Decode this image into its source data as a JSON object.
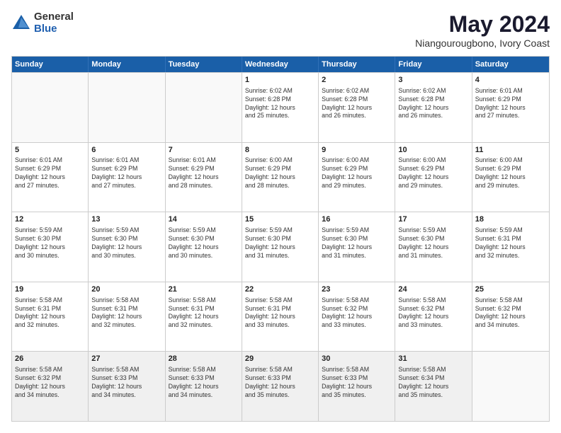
{
  "logo": {
    "general": "General",
    "blue": "Blue"
  },
  "title": "May 2024",
  "subtitle": "Niangourougbono, Ivory Coast",
  "days": [
    "Sunday",
    "Monday",
    "Tuesday",
    "Wednesday",
    "Thursday",
    "Friday",
    "Saturday"
  ],
  "rows": [
    [
      {
        "day": "",
        "text": ""
      },
      {
        "day": "",
        "text": ""
      },
      {
        "day": "",
        "text": ""
      },
      {
        "day": "1",
        "text": "Sunrise: 6:02 AM\nSunset: 6:28 PM\nDaylight: 12 hours\nand 25 minutes."
      },
      {
        "day": "2",
        "text": "Sunrise: 6:02 AM\nSunset: 6:28 PM\nDaylight: 12 hours\nand 26 minutes."
      },
      {
        "day": "3",
        "text": "Sunrise: 6:02 AM\nSunset: 6:28 PM\nDaylight: 12 hours\nand 26 minutes."
      },
      {
        "day": "4",
        "text": "Sunrise: 6:01 AM\nSunset: 6:29 PM\nDaylight: 12 hours\nand 27 minutes."
      }
    ],
    [
      {
        "day": "5",
        "text": "Sunrise: 6:01 AM\nSunset: 6:29 PM\nDaylight: 12 hours\nand 27 minutes."
      },
      {
        "day": "6",
        "text": "Sunrise: 6:01 AM\nSunset: 6:29 PM\nDaylight: 12 hours\nand 27 minutes."
      },
      {
        "day": "7",
        "text": "Sunrise: 6:01 AM\nSunset: 6:29 PM\nDaylight: 12 hours\nand 28 minutes."
      },
      {
        "day": "8",
        "text": "Sunrise: 6:00 AM\nSunset: 6:29 PM\nDaylight: 12 hours\nand 28 minutes."
      },
      {
        "day": "9",
        "text": "Sunrise: 6:00 AM\nSunset: 6:29 PM\nDaylight: 12 hours\nand 29 minutes."
      },
      {
        "day": "10",
        "text": "Sunrise: 6:00 AM\nSunset: 6:29 PM\nDaylight: 12 hours\nand 29 minutes."
      },
      {
        "day": "11",
        "text": "Sunrise: 6:00 AM\nSunset: 6:29 PM\nDaylight: 12 hours\nand 29 minutes."
      }
    ],
    [
      {
        "day": "12",
        "text": "Sunrise: 5:59 AM\nSunset: 6:30 PM\nDaylight: 12 hours\nand 30 minutes."
      },
      {
        "day": "13",
        "text": "Sunrise: 5:59 AM\nSunset: 6:30 PM\nDaylight: 12 hours\nand 30 minutes."
      },
      {
        "day": "14",
        "text": "Sunrise: 5:59 AM\nSunset: 6:30 PM\nDaylight: 12 hours\nand 30 minutes."
      },
      {
        "day": "15",
        "text": "Sunrise: 5:59 AM\nSunset: 6:30 PM\nDaylight: 12 hours\nand 31 minutes."
      },
      {
        "day": "16",
        "text": "Sunrise: 5:59 AM\nSunset: 6:30 PM\nDaylight: 12 hours\nand 31 minutes."
      },
      {
        "day": "17",
        "text": "Sunrise: 5:59 AM\nSunset: 6:30 PM\nDaylight: 12 hours\nand 31 minutes."
      },
      {
        "day": "18",
        "text": "Sunrise: 5:59 AM\nSunset: 6:31 PM\nDaylight: 12 hours\nand 32 minutes."
      }
    ],
    [
      {
        "day": "19",
        "text": "Sunrise: 5:58 AM\nSunset: 6:31 PM\nDaylight: 12 hours\nand 32 minutes."
      },
      {
        "day": "20",
        "text": "Sunrise: 5:58 AM\nSunset: 6:31 PM\nDaylight: 12 hours\nand 32 minutes."
      },
      {
        "day": "21",
        "text": "Sunrise: 5:58 AM\nSunset: 6:31 PM\nDaylight: 12 hours\nand 32 minutes."
      },
      {
        "day": "22",
        "text": "Sunrise: 5:58 AM\nSunset: 6:31 PM\nDaylight: 12 hours\nand 33 minutes."
      },
      {
        "day": "23",
        "text": "Sunrise: 5:58 AM\nSunset: 6:32 PM\nDaylight: 12 hours\nand 33 minutes."
      },
      {
        "day": "24",
        "text": "Sunrise: 5:58 AM\nSunset: 6:32 PM\nDaylight: 12 hours\nand 33 minutes."
      },
      {
        "day": "25",
        "text": "Sunrise: 5:58 AM\nSunset: 6:32 PM\nDaylight: 12 hours\nand 34 minutes."
      }
    ],
    [
      {
        "day": "26",
        "text": "Sunrise: 5:58 AM\nSunset: 6:32 PM\nDaylight: 12 hours\nand 34 minutes."
      },
      {
        "day": "27",
        "text": "Sunrise: 5:58 AM\nSunset: 6:33 PM\nDaylight: 12 hours\nand 34 minutes."
      },
      {
        "day": "28",
        "text": "Sunrise: 5:58 AM\nSunset: 6:33 PM\nDaylight: 12 hours\nand 34 minutes."
      },
      {
        "day": "29",
        "text": "Sunrise: 5:58 AM\nSunset: 6:33 PM\nDaylight: 12 hours\nand 35 minutes."
      },
      {
        "day": "30",
        "text": "Sunrise: 5:58 AM\nSunset: 6:33 PM\nDaylight: 12 hours\nand 35 minutes."
      },
      {
        "day": "31",
        "text": "Sunrise: 5:58 AM\nSunset: 6:34 PM\nDaylight: 12 hours\nand 35 minutes."
      },
      {
        "day": "",
        "text": ""
      }
    ]
  ]
}
